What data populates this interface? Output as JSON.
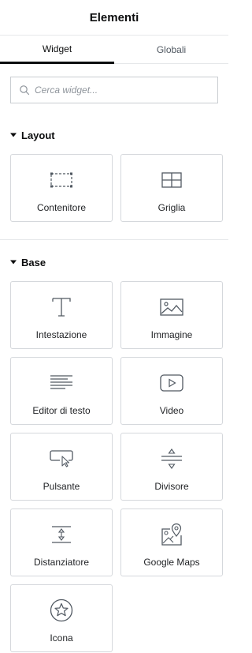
{
  "header": {
    "title": "Elementi"
  },
  "tabs": [
    {
      "label": "Widget",
      "active": true
    },
    {
      "label": "Globali",
      "active": false
    }
  ],
  "search": {
    "placeholder": "Cerca widget...",
    "value": ""
  },
  "sections": [
    {
      "title": "Layout",
      "widgets": [
        {
          "label": "Contenitore",
          "icon": "container-icon"
        },
        {
          "label": "Griglia",
          "icon": "grid-icon"
        }
      ]
    },
    {
      "title": "Base",
      "widgets": [
        {
          "label": "Intestazione",
          "icon": "heading-icon"
        },
        {
          "label": "Immagine",
          "icon": "image-icon"
        },
        {
          "label": "Editor di testo",
          "icon": "text-editor-icon"
        },
        {
          "label": "Video",
          "icon": "video-icon"
        },
        {
          "label": "Pulsante",
          "icon": "button-icon"
        },
        {
          "label": "Divisore",
          "icon": "divider-icon"
        },
        {
          "label": "Distanziatore",
          "icon": "spacer-icon"
        },
        {
          "label": "Google Maps",
          "icon": "google-maps-icon"
        },
        {
          "label": "Icona",
          "icon": "star-icon"
        }
      ]
    }
  ],
  "colors": {
    "text": "#1f2124",
    "border": "#d5d8dc",
    "icon": "#515962"
  }
}
